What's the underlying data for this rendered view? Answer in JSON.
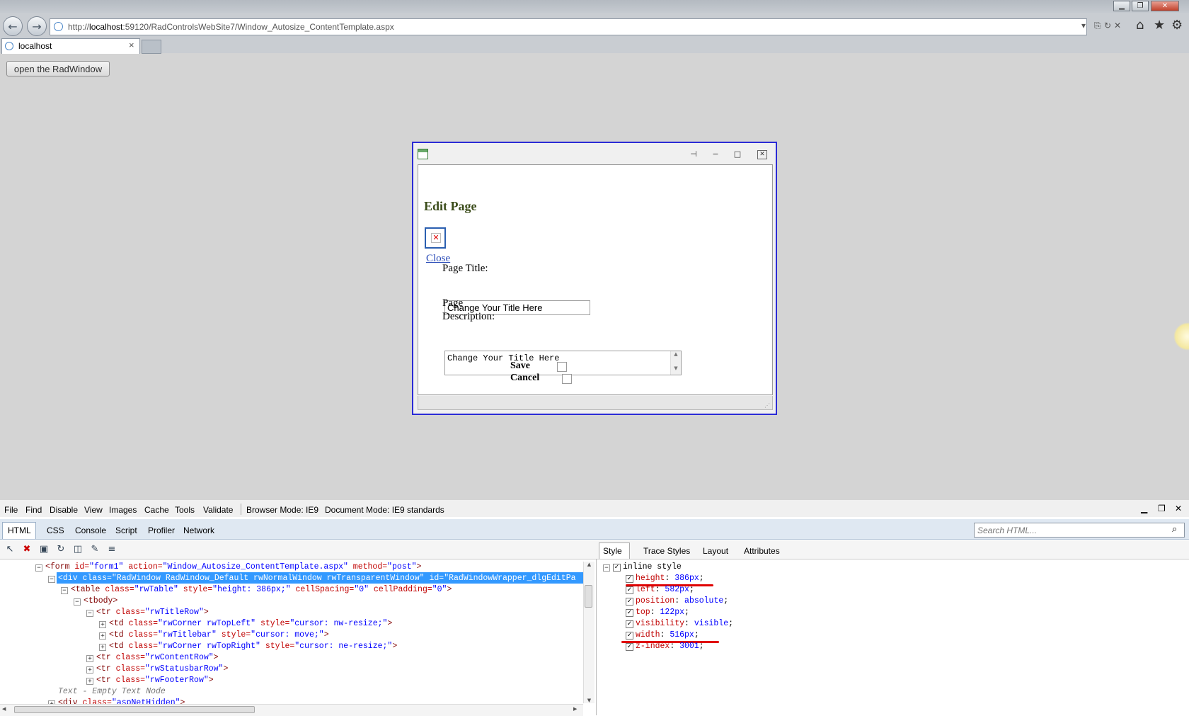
{
  "browser": {
    "url_prefix": "http://",
    "url_host": "localhost",
    "url_rest": ":59120/RadControlsWebSite7/Window_Autosize_ContentTemplate.aspx",
    "tab_title": "localhost",
    "tab_close": "×",
    "icons": {
      "back": "left-arrow-icon",
      "forward": "right-arrow-icon",
      "home": "home-icon",
      "favorites": "star-icon",
      "tools": "gear-icon"
    }
  },
  "page": {
    "open_button_label": "open the RadWindow"
  },
  "radwindow": {
    "heading": "Edit Page",
    "close_link": "Close",
    "page_title_label": "Page Title:",
    "page_title_value": "Change Your Title Here",
    "page_desc_label_1": "Page",
    "page_desc_label_2": "Description:",
    "page_desc_value": "Change Your Title Here",
    "save_label": "Save",
    "cancel_label": "Cancel",
    "border_color": "#2b2bd6"
  },
  "devtools": {
    "menu": [
      "File",
      "Find",
      "Disable",
      "View",
      "Images",
      "Cache",
      "Tools",
      "Validate"
    ],
    "browser_mode": "Browser Mode: IE9",
    "document_mode": "Document Mode: IE9 standards",
    "tabs": [
      "HTML",
      "CSS",
      "Console",
      "Script",
      "Profiler",
      "Network"
    ],
    "search_placeholder": "Search HTML...",
    "right_tabs": [
      "Style",
      "Trace Styles",
      "Layout",
      "Attributes"
    ],
    "tree": [
      {
        "indent": 0,
        "tag": "<form",
        "parts": [
          [
            "id=",
            "\"form1\""
          ],
          [
            "action=",
            "\"Window_Autosize_ContentTemplate.aspx\""
          ],
          [
            "method=",
            "\"post\""
          ]
        ],
        "close": ">",
        "expander": "−"
      },
      {
        "indent": 1,
        "raw": "<div class=\"RadWindow RadWindow_Default rwNormalWindow rwTransparentWindow\" id=\"RadWindowWrapper_dlgEditPa",
        "selected": true,
        "expander": "−"
      },
      {
        "indent": 2,
        "tag": "<table",
        "parts": [
          [
            "class=",
            "\"rwTable\""
          ],
          [
            "style=",
            "\"height: 386px;\""
          ],
          [
            "cellSpacing=",
            "\"0\""
          ],
          [
            "cellPadding=",
            "\"0\""
          ]
        ],
        "close": ">",
        "expander": "−"
      },
      {
        "indent": 3,
        "tag": "<tbody",
        "parts": [],
        "close": ">",
        "expander": "−"
      },
      {
        "indent": 4,
        "tag": "<tr",
        "parts": [
          [
            "class=",
            "\"rwTitleRow\""
          ]
        ],
        "close": ">",
        "expander": "−"
      },
      {
        "indent": 5,
        "tag": "<td",
        "parts": [
          [
            "class=",
            "\"rwCorner rwTopLeft\""
          ],
          [
            "style=",
            "\"cursor: nw-resize;\""
          ]
        ],
        "close": ">",
        "expander": "+"
      },
      {
        "indent": 5,
        "tag": "<td",
        "parts": [
          [
            "class=",
            "\"rwTitlebar\""
          ],
          [
            "style=",
            "\"cursor: move;\""
          ]
        ],
        "close": ">",
        "expander": "+"
      },
      {
        "indent": 5,
        "tag": "<td",
        "parts": [
          [
            "class=",
            "\"rwCorner rwTopRight\""
          ],
          [
            "style=",
            "\"cursor: ne-resize;\""
          ]
        ],
        "close": ">",
        "expander": "+"
      },
      {
        "indent": 4,
        "tag": "<tr",
        "parts": [
          [
            "class=",
            "\"rwContentRow\""
          ]
        ],
        "close": ">",
        "expander": "+"
      },
      {
        "indent": 4,
        "tag": "<tr",
        "parts": [
          [
            "class=",
            "\"rwStatusbarRow\""
          ]
        ],
        "close": ">",
        "expander": "+"
      },
      {
        "indent": 4,
        "tag": "<tr",
        "parts": [
          [
            "class=",
            "\"rwFooterRow\""
          ]
        ],
        "close": ">",
        "expander": "+"
      },
      {
        "indent": 1,
        "text": "Text - Empty Text Node"
      },
      {
        "indent": 1,
        "tag": "<div",
        "parts": [
          [
            "class=",
            "\"aspNetHidden\""
          ]
        ],
        "close": ">",
        "expander": "+"
      }
    ],
    "style_header": "inline style",
    "style_rows": [
      {
        "prop": "height",
        "value": "386px",
        "underlined": true
      },
      {
        "prop": "left",
        "value": "582px"
      },
      {
        "prop": "position",
        "value": "absolute"
      },
      {
        "prop": "top",
        "value": "122px"
      },
      {
        "prop": "visibility",
        "value": "visible"
      },
      {
        "prop": "width",
        "value": "516px",
        "underlined": true
      },
      {
        "prop": "z-index",
        "value": "3001"
      }
    ],
    "highlight_color": "#3399ff",
    "annotation_color": "#e00000"
  }
}
